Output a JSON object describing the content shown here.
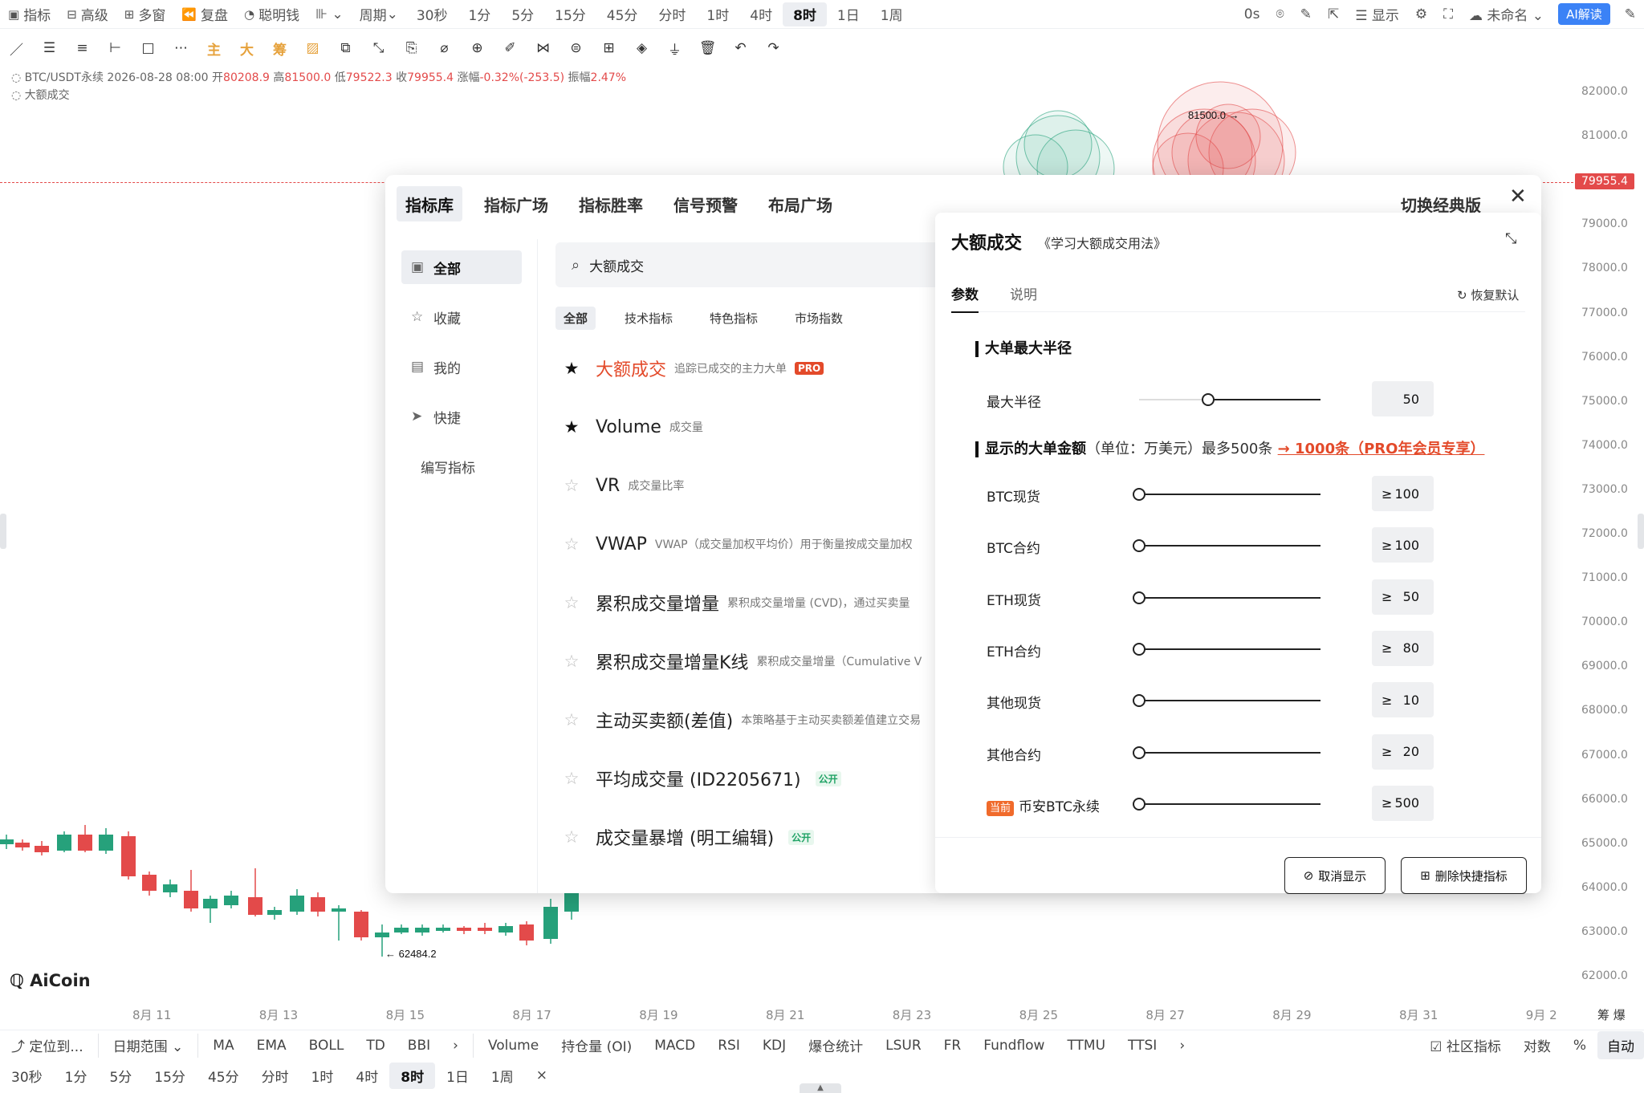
{
  "topbar": {
    "left_items": [
      {
        "icon": "indicator-icon",
        "glyph": "▣",
        "label": "指标"
      },
      {
        "icon": "advanced-icon",
        "glyph": "⊟",
        "label": "高级"
      },
      {
        "icon": "multi-window-icon",
        "glyph": "⊞",
        "label": "多窗"
      },
      {
        "icon": "replay-icon",
        "glyph": "⏪",
        "label": "复盘"
      },
      {
        "icon": "smart-money-icon",
        "glyph": "◔",
        "label": "聪明钱"
      }
    ],
    "chart_type_glyph": "⊪ ⌄",
    "period_label": "周期",
    "timeframes": [
      "30秒",
      "1分",
      "5分",
      "15分",
      "45分",
      "分时",
      "1时",
      "4时",
      "8时",
      "1日",
      "1周"
    ],
    "active_timeframe": "8时",
    "right_items": [
      {
        "name": "countdown",
        "label": "0s"
      },
      {
        "name": "camera-icon",
        "label": "⌾"
      },
      {
        "name": "pen-icon",
        "label": "✎"
      },
      {
        "name": "share-icon",
        "label": "⇱"
      },
      {
        "name": "display-toggle",
        "label": "☰ 显示"
      },
      {
        "name": "settings-icon",
        "label": "⚙"
      },
      {
        "name": "fullscreen-icon",
        "label": "⛶"
      },
      {
        "name": "layout-name",
        "label": "☁ 未命名 ⌄"
      }
    ],
    "ai_button": "AI解读",
    "ai_color": "#3b82f6"
  },
  "drawbar": [
    "／",
    "☰",
    "≡",
    "⊢",
    "□",
    "⋯",
    "主",
    "大",
    "筹",
    "▨",
    "⧉",
    "⤡",
    "⎘",
    "⌀",
    "⊕",
    "✐",
    "⋈",
    "⊜",
    "⊞",
    "◈",
    "⏚",
    "🗑",
    "↶",
    "↷"
  ],
  "info": {
    "symbol": "BTC/USDT永续",
    "datetime": "2026-08-28 08:00",
    "open_label": "开",
    "open": "80208.9",
    "high_label": "高",
    "high": "81500.0",
    "low_label": "低",
    "low": "79522.3",
    "close_label": "收",
    "close": "79955.4",
    "change_label": "涨幅",
    "change": "-0.32%(-253.5)",
    "amp_label": "振幅",
    "amp": "2.47%",
    "indicator_label": "大额成交"
  },
  "price_axis": [
    "82000.0",
    "81000.0",
    "79000.0",
    "78000.0",
    "77000.0",
    "76000.0",
    "75000.0",
    "74000.0",
    "73000.0",
    "72000.0",
    "71000.0",
    "70000.0",
    "69000.0",
    "68000.0",
    "67000.0",
    "66000.0",
    "65000.0",
    "64000.0",
    "63000.0",
    "62000.0"
  ],
  "current_price": "79955.4",
  "bubble_label": "81500.0 →",
  "low_label": "← 62484.2",
  "date_axis": [
    "8月 11",
    "8月 13",
    "8月 15",
    "8月 17",
    "8月 19",
    "8月 21",
    "8月 23",
    "8月 25",
    "8月 27",
    "8月 29",
    "8月 31",
    "9月 2"
  ],
  "date_axis_right": "筹  爆",
  "logo": "AiCoin",
  "indicator_bar": {
    "locate": "⤴ 定位到...",
    "date_range": "日期范围 ⌄",
    "main": [
      "MA",
      "EMA",
      "BOLL",
      "TD",
      "BBI",
      "›"
    ],
    "sub": [
      "Volume",
      "持仓量 (OI)",
      "MACD",
      "RSI",
      "KDJ",
      "爆仓统计",
      "LSUR",
      "FR",
      "Fundflow",
      "TTMU",
      "TTSI",
      "›"
    ],
    "community": "☑ 社区指标",
    "log": "对数",
    "percent": "%",
    "auto": "自动"
  },
  "bottom_timeframes": [
    "30秒",
    "1分",
    "5分",
    "15分",
    "45分",
    "分时",
    "1时",
    "4时",
    "8时",
    "1日",
    "1周"
  ],
  "bottom_active": "8时",
  "bottom_close": "×",
  "modal": {
    "tabs": [
      "指标库",
      "指标广场",
      "指标胜率",
      "信号预警",
      "布局广场"
    ],
    "active_tab": "指标库",
    "switch_classic": "切换经典版",
    "close": "✕",
    "sidenav": [
      {
        "icon": "all-icon",
        "glyph": "▣",
        "label": "全部"
      },
      {
        "icon": "star-icon",
        "glyph": "☆",
        "label": "收藏"
      },
      {
        "icon": "mine-icon",
        "glyph": "▤",
        "label": "我的"
      },
      {
        "icon": "shortcut-icon",
        "glyph": "➤",
        "label": "快捷"
      },
      {
        "icon": "",
        "glyph": "",
        "label": "编写指标"
      }
    ],
    "active_nav": "全部",
    "search_value": "大额成交",
    "filters": [
      "全部",
      "技术指标",
      "特色指标",
      "市场指数"
    ],
    "active_filter": "全部",
    "indicators": [
      {
        "starred": true,
        "name": "大额成交",
        "desc": "追踪已成交的主力大单",
        "badge": "PRO",
        "highlight": true
      },
      {
        "starred": true,
        "name": "Volume",
        "desc": "成交量",
        "badge": ""
      },
      {
        "starred": false,
        "name": "VR",
        "desc": "成交量比率",
        "badge": ""
      },
      {
        "starred": false,
        "name": "VWAP",
        "desc": "VWAP（成交量加权平均价）用于衡量按成交量加权",
        "badge": ""
      },
      {
        "starred": false,
        "name": "累积成交量增量",
        "desc": "累积成交量增量 (CVD)，通过买卖量",
        "badge": ""
      },
      {
        "starred": false,
        "name": "累积成交量增量K线",
        "desc": "累积成交量增量（Cumulative V",
        "badge": ""
      },
      {
        "starred": false,
        "name": "主动买卖额(差值)",
        "desc": "本策略基于主动买卖额差值建立交易",
        "badge": ""
      },
      {
        "starred": false,
        "name": "平均成交量 (ID2205671)",
        "desc": "",
        "badge": "公开"
      },
      {
        "starred": false,
        "name": "成交量暴增 (明工编辑)",
        "desc": "",
        "badge": "公开"
      }
    ]
  },
  "detail": {
    "title": "大额成交",
    "link": "《学习大额成交用法》",
    "collapse": "⤡",
    "tabs": [
      "参数",
      "说明"
    ],
    "active_tab": "参数",
    "reset": "↻ 恢复默认",
    "section1": "大单最大半径",
    "radius": {
      "label": "最大半径",
      "value": "50",
      "level": 0.38
    },
    "section2_title": "显示的大单金额",
    "section2_unit": "（单位：万美元）最多500条",
    "section2_promo": "→ 1000条（PRO年会员专享）",
    "op": "≥",
    "amounts": [
      {
        "label": "BTC现货",
        "value": "100",
        "current": false
      },
      {
        "label": "BTC合约",
        "value": "100",
        "current": false
      },
      {
        "label": "ETH现货",
        "value": "50",
        "current": false
      },
      {
        "label": "ETH合约",
        "value": "80",
        "current": false
      },
      {
        "label": "其他现货",
        "value": "10",
        "current": false
      },
      {
        "label": "其他合约",
        "value": "20",
        "current": false
      },
      {
        "label": "币安BTC永续",
        "value": "500",
        "current": true,
        "tag": "当前"
      }
    ],
    "cancel_btn": "取消显示",
    "delete_btn": "删除快捷指标"
  },
  "colors": {
    "up": "#26a17b",
    "down": "#e34a4a",
    "accent": "#e34a2a"
  }
}
